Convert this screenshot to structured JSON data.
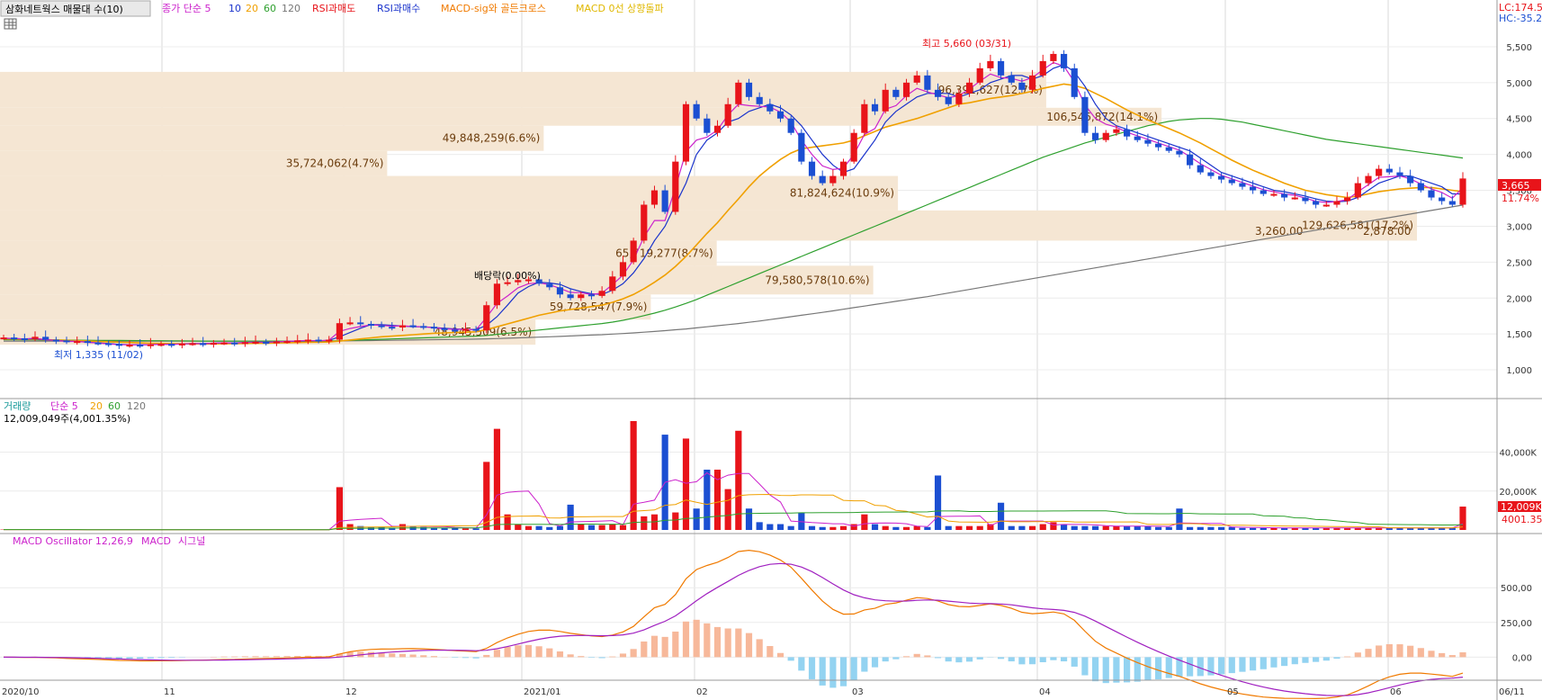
{
  "chart_data": {
    "type": "line",
    "title": "삼화네트웍스 매물대 수(10)",
    "legend_price": [
      "종가 단순 5",
      "10",
      "20",
      "60",
      "120",
      "RSI과매도",
      "RSI과매수",
      "MACD-sig와 골든크로스",
      "MACD 0선 상향돌파"
    ],
    "price_axis": {
      "ylim": [
        700,
        5800
      ],
      "ticks": [
        "5,500",
        "5,000",
        "4,500",
        "4,000",
        "3,500",
        "3,000",
        "2,500",
        "2,000",
        "1,500",
        "1,000"
      ],
      "tick_values": [
        5500,
        5000,
        4500,
        4000,
        3500,
        3000,
        2500,
        2000,
        1500,
        1000
      ]
    },
    "lc_label": "LC:174.53",
    "hc_label": "HC:-35.28",
    "last_price": "3,665",
    "last_change": "11.74%",
    "max_label": "최고 5,660 (03/31)",
    "min_label": "최저 1,335 (11/02)",
    "dividend_label": "배당락(0.00%)",
    "x_labels": [
      "2020/10",
      "11",
      "12",
      "2021/01",
      "02",
      "03",
      "04",
      "05",
      "06",
      "06/11"
    ],
    "volume_profile": [
      {
        "low": 4650,
        "high": 5150,
        "label": "96,391,627(12.7%)"
      },
      {
        "low": 4400,
        "high": 4650,
        "label": "106,546,872(14.1%)"
      },
      {
        "low": 4050,
        "high": 4400,
        "label": "49,848,259(6.6%)"
      },
      {
        "low": 3700,
        "high": 4050,
        "label": "35,724,062(4.7%)"
      },
      {
        "low": 3220,
        "high": 3700,
        "label": "81,824,624(10.9%)"
      },
      {
        "low": 2800,
        "high": 3220,
        "label": "129,626,581(17.2%)"
      },
      {
        "low": 2450,
        "high": 2800,
        "label": "65,719,277(8.7%)"
      },
      {
        "low": 2050,
        "high": 2450,
        "label": "79,580,578(10.6%)"
      },
      {
        "low": 1700,
        "high": 2050,
        "label": "59,728,547(7.9%)"
      },
      {
        "low": 1350,
        "high": 1700,
        "label": "48,945,509(6.5%)"
      }
    ],
    "extra_labels": [
      "3,260.00",
      "2,878.00"
    ],
    "candles_close": [
      1450,
      1440,
      1430,
      1460,
      1420,
      1410,
      1390,
      1400,
      1380,
      1370,
      1360,
      1340,
      1350,
      1345,
      1355,
      1360,
      1350,
      1365,
      1370,
      1360,
      1375,
      1380,
      1370,
      1385,
      1390,
      1380,
      1395,
      1400,
      1410,
      1420,
      1400,
      1420,
      1650,
      1660,
      1640,
      1620,
      1600,
      1590,
      1620,
      1610,
      1600,
      1580,
      1560,
      1550,
      1570,
      1550,
      1900,
      2200,
      2220,
      2250,
      2260,
      2200,
      2150,
      2050,
      2000,
      2050,
      2030,
      2100,
      2300,
      2500,
      2800,
      3300,
      3500,
      3200,
      3900,
      4700,
      4500,
      4300,
      4400,
      4700,
      5000,
      4800,
      4700,
      4600,
      4500,
      4300,
      3900,
      3700,
      3600,
      3700,
      3900,
      4300,
      4700,
      4600,
      4900,
      4800,
      5000,
      5100,
      4900,
      4800,
      4700,
      4850,
      5000,
      5200,
      5300,
      5100,
      5000,
      4900,
      5100,
      5300,
      5400,
      5200,
      4800,
      4300,
      4200,
      4300,
      4350,
      4250,
      4200,
      4150,
      4100,
      4050,
      4000,
      3850,
      3750,
      3700,
      3650,
      3600,
      3550,
      3500,
      3450,
      3450,
      3400,
      3400,
      3350,
      3300,
      3300,
      3350,
      3400,
      3600,
      3700,
      3800,
      3750,
      3700,
      3600,
      3500,
      3400,
      3350,
      3300,
      3665
    ],
    "ma5": [
      1440,
      1435,
      1430,
      1430,
      1420,
      1410,
      1400,
      1395,
      1385,
      1375,
      1365,
      1355,
      1350,
      1350,
      1350,
      1355,
      1355,
      1360,
      1365,
      1365,
      1370,
      1375,
      1375,
      1380,
      1385,
      1385,
      1390,
      1395,
      1400,
      1405,
      1405,
      1410,
      1460,
      1520,
      1580,
      1630,
      1630,
      1620,
      1610,
      1600,
      1600,
      1590,
      1580,
      1570,
      1565,
      1560,
      1620,
      1740,
      1900,
      2070,
      2160,
      2220,
      2210,
      2190,
      2130,
      2090,
      2060,
      2050,
      2110,
      2200,
      2350,
      2550,
      2800,
      3000,
      3300,
      3600,
      4000,
      4200,
      4300,
      4450,
      4500,
      4600,
      4650,
      4700,
      4650,
      4550,
      4400,
      4200,
      4000,
      3850,
      3750,
      3800,
      4000,
      4200,
      4450,
      4600,
      4700,
      4800,
      4850,
      4850,
      4850,
      4800,
      4850,
      4900,
      5000,
      5050,
      5100,
      5100,
      5050,
      5100,
      5200,
      5250,
      5150,
      4950,
      4700,
      4500,
      4400,
      4350,
      4300,
      4250,
      4200,
      4150,
      4100,
      4050,
      3950,
      3850,
      3750,
      3700,
      3650,
      3600,
      3550,
      3500,
      3480,
      3450,
      3420,
      3380,
      3350,
      3340,
      3350,
      3400,
      3500,
      3600,
      3650,
      3700,
      3700,
      3650,
      3600,
      3550,
      3450,
      3450
    ],
    "ma20": [
      1430,
      1430,
      1425,
      1425,
      1420,
      1415,
      1410,
      1405,
      1400,
      1395,
      1390,
      1385,
      1380,
      1375,
      1370,
      1368,
      1365,
      1363,
      1362,
      1360,
      1362,
      1364,
      1366,
      1368,
      1370,
      1372,
      1375,
      1378,
      1380,
      1383,
      1385,
      1388,
      1400,
      1415,
      1430,
      1445,
      1460,
      1470,
      1480,
      1490,
      1500,
      1510,
      1515,
      1520,
      1525,
      1530,
      1560,
      1600,
      1640,
      1680,
      1720,
      1760,
      1790,
      1820,
      1840,
      1860,
      1880,
      1900,
      1940,
      1990,
      2050,
      2130,
      2220,
      2320,
      2440,
      2580,
      2740,
      2900,
      3050,
      3220,
      3380,
      3550,
      3700,
      3820,
      3930,
      4020,
      4080,
      4100,
      4120,
      4140,
      4160,
      4200,
      4260,
      4320,
      4380,
      4420,
      4460,
      4500,
      4550,
      4600,
      4650,
      4700,
      4720,
      4750,
      4780,
      4800,
      4820,
      4850,
      4880,
      4920,
      4950,
      4980,
      4960,
      4920,
      4850,
      4780,
      4700,
      4620,
      4550,
      4480,
      4420,
      4360,
      4300,
      4230,
      4160,
      4080,
      4000,
      3920,
      3850,
      3780,
      3720,
      3660,
      3600,
      3550,
      3500,
      3470,
      3440,
      3420,
      3400,
      3420,
      3450,
      3480,
      3500,
      3520,
      3530,
      3540,
      3540,
      3520,
      3500,
      3480
    ],
    "ma60": [
      1420,
      1420,
      1418,
      1418,
      1416,
      1415,
      1414,
      1413,
      1412,
      1411,
      1410,
      1409,
      1408,
      1407,
      1406,
      1405,
      1404,
      1403,
      1402,
      1401,
      1400,
      1400,
      1400,
      1400,
      1400,
      1400,
      1400,
      1400,
      1400,
      1400,
      1400,
      1400,
      1405,
      1410,
      1415,
      1420,
      1425,
      1430,
      1435,
      1440,
      1445,
      1450,
      1455,
      1460,
      1465,
      1470,
      1480,
      1495,
      1510,
      1525,
      1540,
      1555,
      1570,
      1585,
      1600,
      1615,
      1630,
      1645,
      1665,
      1690,
      1720,
      1755,
      1790,
      1830,
      1875,
      1925,
      1980,
      2040,
      2100,
      2160,
      2220,
      2280,
      2340,
      2400,
      2460,
      2520,
      2580,
      2640,
      2700,
      2760,
      2820,
      2880,
      2940,
      3000,
      3060,
      3120,
      3180,
      3240,
      3300,
      3360,
      3420,
      3480,
      3540,
      3600,
      3660,
      3720,
      3780,
      3840,
      3900,
      3960,
      4010,
      4060,
      4110,
      4160,
      4200,
      4240,
      4280,
      4320,
      4360,
      4400,
      4430,
      4460,
      4480,
      4490,
      4500,
      4500,
      4490,
      4470,
      4450,
      4420,
      4390,
      4360,
      4330,
      4300,
      4270,
      4240,
      4210,
      4190,
      4170,
      4150,
      4130,
      4110,
      4090,
      4070,
      4050,
      4030,
      4010,
      3990,
      3970,
      3950
    ],
    "ma120": [
      1400,
      1400,
      1400,
      1400,
      1400,
      1400,
      1400,
      1400,
      1400,
      1400,
      1400,
      1400,
      1400,
      1400,
      1400,
      1400,
      1400,
      1400,
      1400,
      1400,
      1400,
      1400,
      1400,
      1400,
      1400,
      1400,
      1400,
      1400,
      1400,
      1400,
      1400,
      1400,
      1402,
      1404,
      1406,
      1408,
      1410,
      1412,
      1414,
      1416,
      1418,
      1420,
      1422,
      1424,
      1426,
      1428,
      1432,
      1436,
      1440,
      1445,
      1450,
      1455,
      1460,
      1466,
      1472,
      1478,
      1484,
      1490,
      1498,
      1506,
      1515,
      1525,
      1535,
      1546,
      1558,
      1570,
      1585,
      1600,
      1615,
      1630,
      1645,
      1662,
      1680,
      1700,
      1720,
      1740,
      1760,
      1780,
      1800,
      1822,
      1844,
      1866,
      1888,
      1910,
      1932,
      1954,
      1976,
      1998,
      2020,
      2045,
      2070,
      2095,
      2120,
      2145,
      2170,
      2195,
      2220,
      2245,
      2270,
      2295,
      2320,
      2345,
      2370,
      2395,
      2420,
      2445,
      2470,
      2495,
      2520,
      2545,
      2570,
      2595,
      2620,
      2645,
      2670,
      2695,
      2720,
      2745,
      2770,
      2795,
      2820,
      2845,
      2870,
      2895,
      2920,
      2945,
      2970,
      2995,
      3020,
      3045,
      3070,
      3095,
      3120,
      3145,
      3170,
      3195,
      3220,
      3245,
      3270,
      3295
    ],
    "volume_panel": {
      "title": "거래량",
      "legend": [
        "단순 5",
        "20",
        "60",
        "120"
      ],
      "current": "12,009,049주(4,001.35%)",
      "ticks": [
        "40,000K",
        "20,000K"
      ],
      "tick_values": [
        40000,
        20000
      ],
      "ylim": [
        0,
        62000
      ],
      "last_label": "12,009K",
      "last_ratio": "4001.35%",
      "values": [
        200,
        200,
        200,
        150,
        150,
        150,
        150,
        100,
        100,
        100,
        100,
        100,
        100,
        100,
        100,
        100,
        100,
        100,
        100,
        100,
        100,
        100,
        100,
        100,
        100,
        100,
        100,
        100,
        100,
        100,
        100,
        100,
        22000,
        3000,
        2000,
        1500,
        1500,
        1200,
        3000,
        2000,
        1500,
        1200,
        1000,
        1000,
        800,
        800,
        35000,
        52000,
        8000,
        3000,
        2000,
        2000,
        1500,
        2000,
        13000,
        3000,
        2500,
        2500,
        3000,
        2500,
        56000,
        7000,
        8000,
        49000,
        9000,
        47000,
        11000,
        31000,
        31000,
        21000,
        51000,
        11000,
        4000,
        3000,
        3000,
        2000,
        9000,
        2000,
        1500,
        1500,
        2000,
        3000,
        8000,
        3000,
        2000,
        1500,
        1500,
        2000,
        1500,
        28000,
        2000,
        2000,
        2000,
        2000,
        3000,
        14000,
        2000,
        2000,
        2000,
        3000,
        4000,
        3000,
        2000,
        2000,
        2000,
        2000,
        2000,
        2000,
        2000,
        2000,
        1500,
        1500,
        11000,
        1500,
        1500,
        1500,
        1500,
        1500,
        1000,
        1000,
        1000,
        1000,
        1000,
        1000,
        1000,
        1000,
        1000,
        1000,
        1000,
        1000,
        1000,
        1000,
        1000,
        1000,
        1000,
        1000,
        1000,
        1000,
        1000,
        12009
      ]
    },
    "macd_panel": {
      "title": "MACD Oscillator 12,26,9",
      "legend": [
        "MACD",
        "시그널"
      ],
      "ticks": [
        "500,00",
        "250,00",
        "0,00"
      ],
      "tick_values": [
        500,
        250,
        0
      ],
      "ylim": [
        -140,
        780
      ]
    }
  },
  "colors": {
    "up": "#e8141a",
    "down": "#1b4fd2",
    "ma5": "#cc22cc",
    "ma10": "#1a33cc",
    "ma20": "#f0a000",
    "ma60": "#2ea02e",
    "ma120": "#777777",
    "profile": "#f5e6d3",
    "profile_text": "#6b3c0c",
    "osc_pos": "#f7b89a",
    "osc_neg": "#93d3f1"
  }
}
